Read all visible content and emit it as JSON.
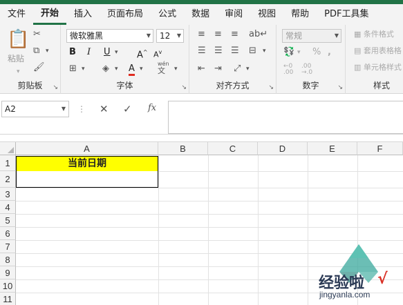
{
  "tabs": [
    "文件",
    "开始",
    "插入",
    "页面布局",
    "公式",
    "数据",
    "审阅",
    "视图",
    "帮助",
    "PDF工具集"
  ],
  "active_tab": "开始",
  "ribbon": {
    "clipboard": {
      "paste_label": "粘贴",
      "group_label": "剪贴板"
    },
    "font": {
      "font_name": "微软雅黑",
      "font_size": "12",
      "bold": "B",
      "italic": "I",
      "underline": "U",
      "grow": "A",
      "shrink": "A",
      "font_color_letter": "A",
      "wen": "wén",
      "wen_char": "文",
      "group_label": "字体"
    },
    "align": {
      "group_label": "对齐方式"
    },
    "number": {
      "format": "常规",
      "percent": "%",
      "group_label": "数字"
    },
    "styles": {
      "cond_format": "条件格式",
      "table_format": "套用表格格",
      "cell_style": "单元格样式",
      "group_label": "样式"
    }
  },
  "formula_bar": {
    "name_box": "A2",
    "cancel": "✕",
    "enter": "✓",
    "fx": "fx",
    "value": ""
  },
  "sheet": {
    "columns": [
      "A",
      "B",
      "C",
      "D",
      "E",
      "F"
    ],
    "rows": [
      "1",
      "2",
      "3",
      "4",
      "5",
      "6",
      "7",
      "8",
      "9",
      "10",
      "11"
    ],
    "a1": "当前日期",
    "a2": ""
  },
  "watermark": {
    "text": "经验啦",
    "url": "jingyanla.com",
    "check": "√"
  },
  "colors": {
    "accent": "#217346",
    "highlight": "#ffff00"
  }
}
